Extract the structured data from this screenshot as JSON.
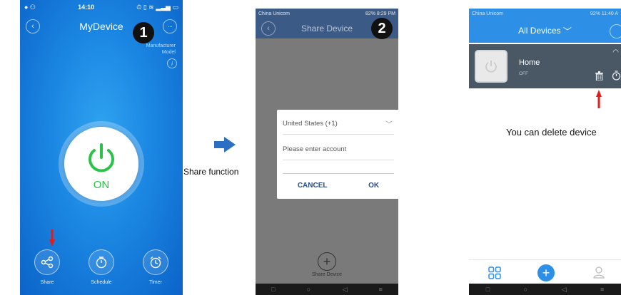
{
  "screen1": {
    "status_time": "14:10",
    "title": "MyDevice",
    "step_badge": "1",
    "meta_manufacturer": "Manufacturer",
    "meta_model": "Model",
    "power_state": "ON",
    "actions": [
      {
        "label": "Share",
        "icon": "share-icon"
      },
      {
        "label": "Schedule",
        "icon": "stopwatch-icon"
      },
      {
        "label": "Timer",
        "icon": "alarm-clock-icon"
      }
    ]
  },
  "middle": {
    "share_function_label": "Share function"
  },
  "screen2": {
    "carrier": "China Unicom",
    "status_right": "82%  8:29 PM",
    "title": "Share Device",
    "step_badge": "2",
    "dialog": {
      "country": "United States (+1)",
      "account_placeholder": "Please enter account",
      "cancel_label": "CANCEL",
      "ok_label": "OK"
    },
    "add_label": "Share Device"
  },
  "screen3": {
    "carrier": "China Unicom",
    "status_right": "92%  11:40 A",
    "title": "All Devices",
    "device": {
      "name": "Home",
      "state": "OFF"
    },
    "delete_message": "You can delete device"
  },
  "colors": {
    "blue_bg": "#1b86e2",
    "power_green": "#2cc24a",
    "arrow_red": "#e21b1b",
    "arrow_blue": "#2a6fc4",
    "dialog_button": "#2a4e86"
  }
}
